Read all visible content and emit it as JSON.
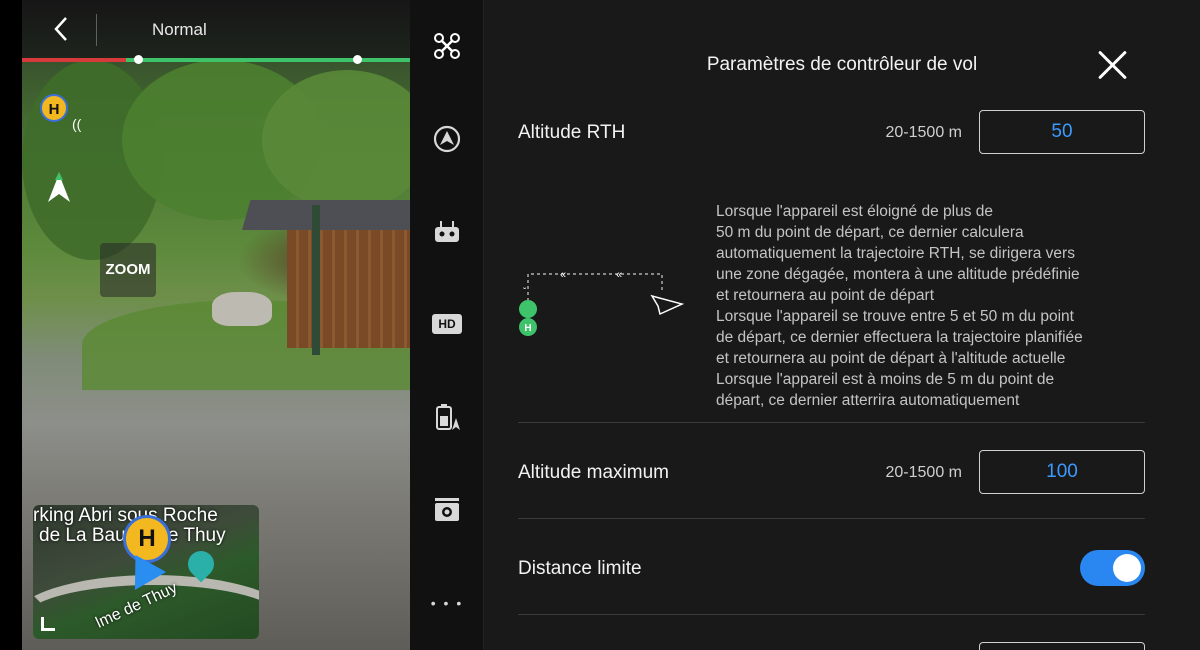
{
  "camera": {
    "mode": "Normal",
    "zoom_label": "ZOOM",
    "home_marker": "H",
    "minimap": {
      "place_line1": "rking Abri sous Roche",
      "place_line2": "de La Baume de Thuy",
      "road_label": "lme de Thuy",
      "home_marker": "H"
    }
  },
  "toolbar": {
    "items": [
      {
        "name": "aircraft-icon"
      },
      {
        "name": "obstacle-sensing-icon"
      },
      {
        "name": "remote-controller-icon"
      },
      {
        "name": "hd-transmission-icon",
        "label": "HD"
      },
      {
        "name": "battery-icon"
      },
      {
        "name": "camera-settings-icon"
      },
      {
        "name": "more-icon",
        "label": "• • •"
      }
    ]
  },
  "panel": {
    "title": "Paramètres de contrôleur de vol",
    "rth_altitude": {
      "label": "Altitude RTH",
      "range": "20-1500 m",
      "value": "50"
    },
    "rth_description": [
      "Lorsque l'appareil est éloigné de plus de",
      "50 m du point de départ, ce dernier calculera",
      "automatiquement la trajectoire RTH, se dirigera vers",
      "une zone dégagée, montera à une altitude prédéfinie",
      "et retournera au point de départ",
      "Lorsque l'appareil se trouve entre 5 et 50 m du point",
      "de départ, ce dernier effectuera la trajectoire planifiée",
      "et retournera au point de départ à l'altitude actuelle",
      "Lorsque l'appareil est à moins de 5 m du point de",
      "départ, ce dernier atterrira automatiquement"
    ],
    "diagram_home": "H",
    "max_altitude": {
      "label": "Altitude maximum",
      "range": "20-1500 m",
      "value": "100"
    },
    "distance_limit": {
      "label": "Distance limite",
      "enabled": true
    }
  },
  "colors": {
    "accent": "#2a86f0",
    "value_text": "#3a9bff",
    "home_marker": "#f3b71f",
    "track_green": "#3ec26a",
    "track_red": "#d63a3a"
  }
}
